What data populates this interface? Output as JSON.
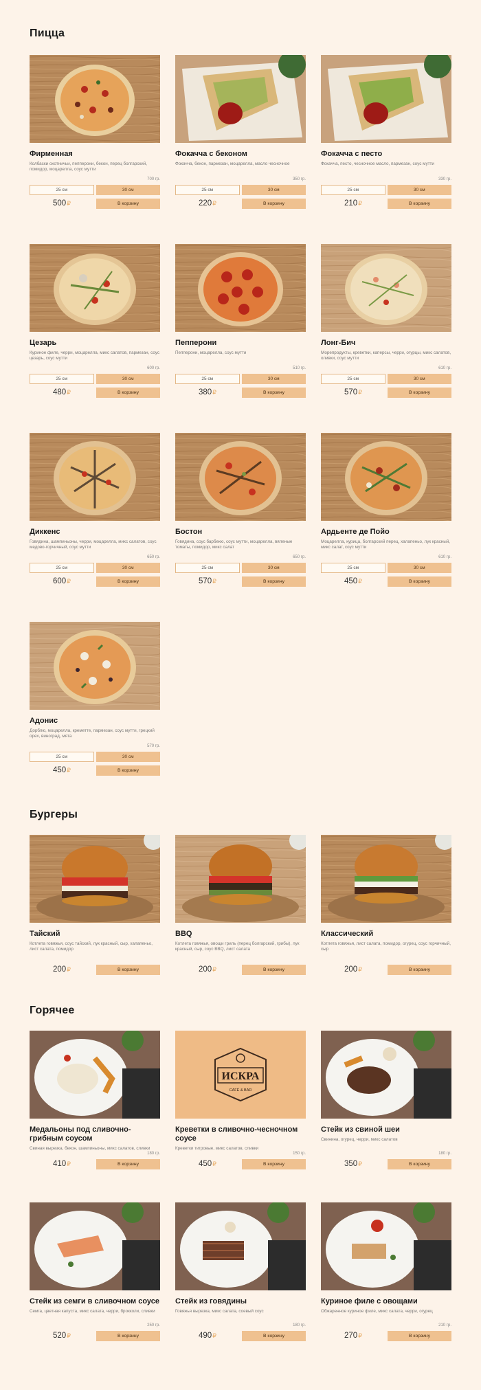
{
  "currency_icon": "ruble-sign-icon",
  "colors": {
    "background": "#fdf3e9",
    "accent": "#efc190",
    "currency": "#e7aa62"
  },
  "sections": {
    "pizza": {
      "title": "Пицца",
      "items": [
        {
          "name": "Фирменная",
          "desc": "Колбаски охотничьи, пепперони, бекон, перец болгарский, помидор, моцарелла, соус мутти",
          "weight": "700 гр.",
          "size_small": "25 см",
          "size_large": "30 см",
          "price": "500",
          "cart": "В корзину"
        },
        {
          "name": "Фокачча с беконом",
          "desc": "Фокачча, бекон, пармезан, моцарелла, масло чесночное",
          "weight": "350 гр.",
          "size_small": "25 см",
          "size_large": "30 см",
          "price": "220",
          "cart": "В корзину"
        },
        {
          "name": "Фокачча с песто",
          "desc": "Фокачча, песто, чесночное масло, пармезан, соус мутти",
          "weight": "330 гр.",
          "size_small": "25 см",
          "size_large": "30 см",
          "price": "210",
          "cart": "В корзину"
        },
        {
          "name": "Цезарь",
          "desc": "Куриное филе, черри, моцарелла, микс салатов, пармезан, соус цезарь, соус мутти",
          "weight": "600 гр.",
          "size_small": "25 см",
          "size_large": "30 см",
          "price": "480",
          "cart": "В корзину"
        },
        {
          "name": "Пепперони",
          "desc": "Пепперони, моцарелла, соус мутти",
          "weight": "510 гр.",
          "size_small": "25 см",
          "size_large": "30 см",
          "price": "380",
          "cart": "В корзину"
        },
        {
          "name": "Лонг-Бич",
          "desc": "Морепродукты, креветки, каперсы, черри, огурцы, микс салатов, оливки, соус мутти",
          "weight": "610 гр.",
          "size_small": "25 см",
          "size_large": "30 см",
          "price": "570",
          "cart": "В корзину"
        },
        {
          "name": "Диккенс",
          "desc": "Говядина, шампиньоны, черри, моцарелла, микс салатов, соус медово-горчичный, соус мутти",
          "weight": "650 гр.",
          "size_small": "25 см",
          "size_large": "30 см",
          "price": "600",
          "cart": "В корзину"
        },
        {
          "name": "Бостон",
          "desc": "Говядина, соус барбекю, соус мутти, моцарелла, вяленые томаты, помидор, микс салат",
          "weight": "650 гр.",
          "size_small": "25 см",
          "size_large": "30 см",
          "price": "570",
          "cart": "В корзину"
        },
        {
          "name": "Ардьенте де Пойо",
          "desc": "Моцарелла, курица, болгарский перец, халапеньо, лук красный, микс салат, соус мутти",
          "weight": "610 гр.",
          "size_small": "25 см",
          "size_large": "30 см",
          "price": "450",
          "cart": "В корзину"
        },
        {
          "name": "Адонис",
          "desc": "Дорблю, моцарелла, креметте, пармезан, соус мутти, грецкий орех, виноград, мята",
          "weight": "570 гр.",
          "size_small": "25 см",
          "size_large": "30 см",
          "price": "450",
          "cart": "В корзину"
        }
      ]
    },
    "burgers": {
      "title": "Бургеры",
      "items": [
        {
          "name": "Тайский",
          "desc": "Котлета говяжья, соус тайский, лук красный, сыр, халапеньо, лист салата, помидор",
          "price": "200",
          "cart": "В корзину"
        },
        {
          "name": "BBQ",
          "desc": "Котлета говяжья, овощи гриль (перец болгарский, грибы), лук красный, сыр, соус BBQ, лист салата",
          "price": "200",
          "cart": "В корзину"
        },
        {
          "name": "Классический",
          "desc": "Котлета говяжья, лист салата, помидор, огурец, соус горчичный, сыр",
          "price": "200",
          "cart": "В корзину"
        }
      ]
    },
    "hot": {
      "title": "Горячее",
      "logo_text": "ИСКРА",
      "logo_sub": "CAFÉ & BAR",
      "items": [
        {
          "name": "Медальоны под сливочно-грибным соусом",
          "desc": "Свиная вырезка, бекон, шампиньоны, микс салатов, сливки",
          "weight": "180 гр.",
          "price": "410",
          "cart": "В корзину"
        },
        {
          "name": "Креветки в сливочно-чесночном соусе",
          "desc": "Креветки тигровые, микс салатов, сливки",
          "weight": "150 гр.",
          "price": "450",
          "cart": "В корзину"
        },
        {
          "name": "Стейк из свиной шеи",
          "desc": "Свинина, огурец, черри, микс салатов",
          "weight": "180 гр.",
          "price": "350",
          "cart": "В корзину"
        },
        {
          "name": "Стейк из семги в сливочном соусе",
          "desc": "Семга, цветная капуста, микс салата, черри, брокколи, сливки",
          "weight": "250 гр.",
          "price": "520",
          "cart": "В корзину"
        },
        {
          "name": "Стейк из говядины",
          "desc": "Говяжья вырезка, микс салата, соевый соус",
          "weight": "180 гр.",
          "price": "490",
          "cart": "В корзину"
        },
        {
          "name": "Куриное филе с овощами",
          "desc": "Обжаренное куриное филе, микс салата, черри, огурец",
          "weight": "210 гр.",
          "price": "270",
          "cart": "В корзину"
        }
      ]
    }
  }
}
